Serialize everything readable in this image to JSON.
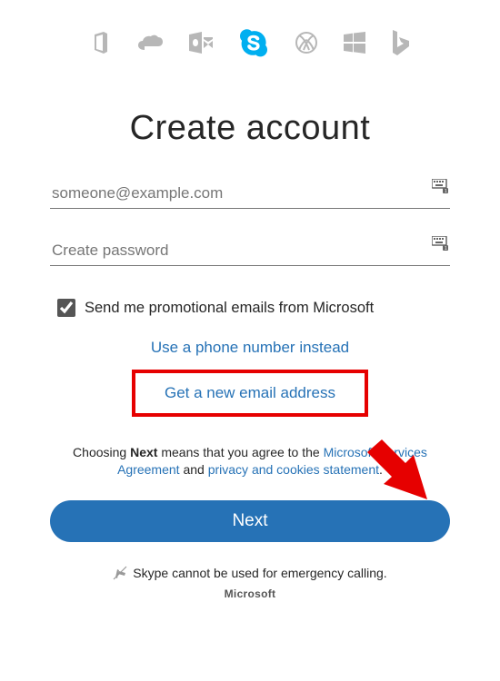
{
  "apps": {
    "office": "office-icon",
    "onedrive": "onedrive-icon",
    "outlook": "outlook-icon",
    "skype": "skype-icon",
    "xbox": "xbox-icon",
    "windows": "windows-icon",
    "bing": "bing-icon"
  },
  "heading": "Create account",
  "email": {
    "placeholder": "someone@example.com",
    "value": ""
  },
  "password": {
    "placeholder": "Create password",
    "value": ""
  },
  "promo": {
    "checked": true,
    "label": "Send me promotional emails from Microsoft"
  },
  "links": {
    "phone": "Use a phone number instead",
    "newEmail": "Get a new email address"
  },
  "agree": {
    "prefix": "Choosing ",
    "bold": "Next",
    "mid": " means that you agree to the ",
    "msa": "Microsoft Services Agreement",
    "and": " and ",
    "privacy": "privacy and cookies statement",
    "suffix": "."
  },
  "nextLabel": "Next",
  "emergency": "Skype cannot be used for emergency calling.",
  "footer": "Microsoft",
  "colors": {
    "accent": "#2672b6",
    "skype": "#00aff0",
    "highlight": "#e60000"
  }
}
